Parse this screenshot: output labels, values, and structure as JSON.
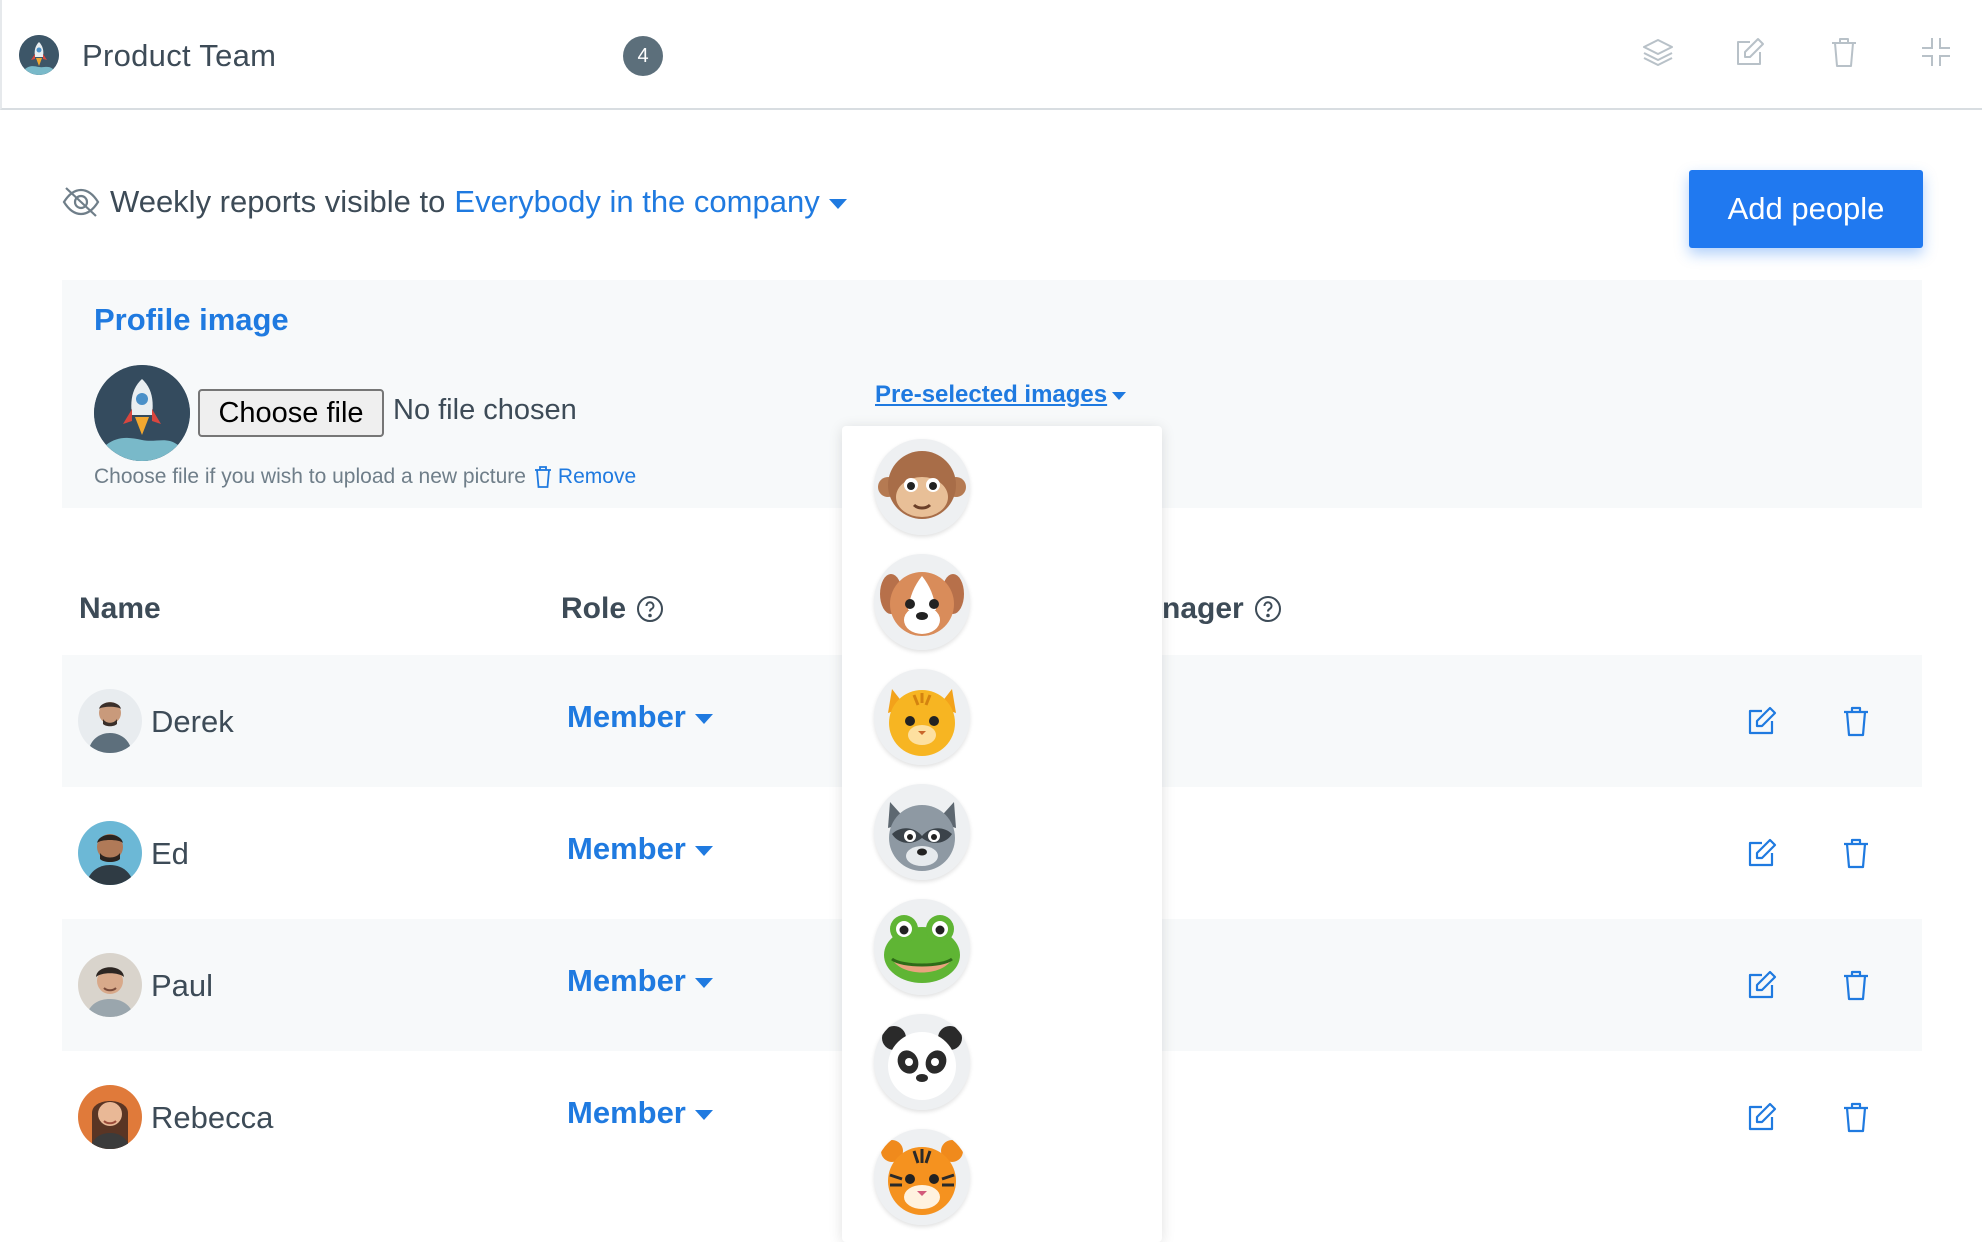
{
  "header": {
    "team_name": "Product Team",
    "member_count": "4",
    "icons": [
      "layers-icon",
      "edit-icon",
      "trash-icon",
      "collapse-icon"
    ]
  },
  "visibility": {
    "label": "Weekly reports visible to",
    "value": "Everybody in the company"
  },
  "add_people_label": "Add people",
  "profile": {
    "title": "Profile image",
    "choose_file_label": "Choose file",
    "no_file_text": "No file chosen",
    "hint": "Choose file if you wish to upload a new picture",
    "remove_label": "Remove",
    "preselected_label": "Pre-selected images"
  },
  "table": {
    "columns": {
      "name": "Name",
      "role": "Role",
      "manager_partial": "nager"
    },
    "rows": [
      {
        "name": "Derek",
        "role": "Member"
      },
      {
        "name": "Ed",
        "role": "Member"
      },
      {
        "name": "Paul",
        "role": "Member"
      },
      {
        "name": "Rebecca",
        "role": "Member"
      }
    ]
  },
  "preselected_images": [
    "monkey",
    "dog",
    "cat",
    "raccoon",
    "frog",
    "panda",
    "tiger"
  ],
  "colors": {
    "accent": "#1f7ae0",
    "button": "#2079f0",
    "badge": "#5c6f7b",
    "panel": "#f7f9fa",
    "text": "#3d4b57"
  }
}
